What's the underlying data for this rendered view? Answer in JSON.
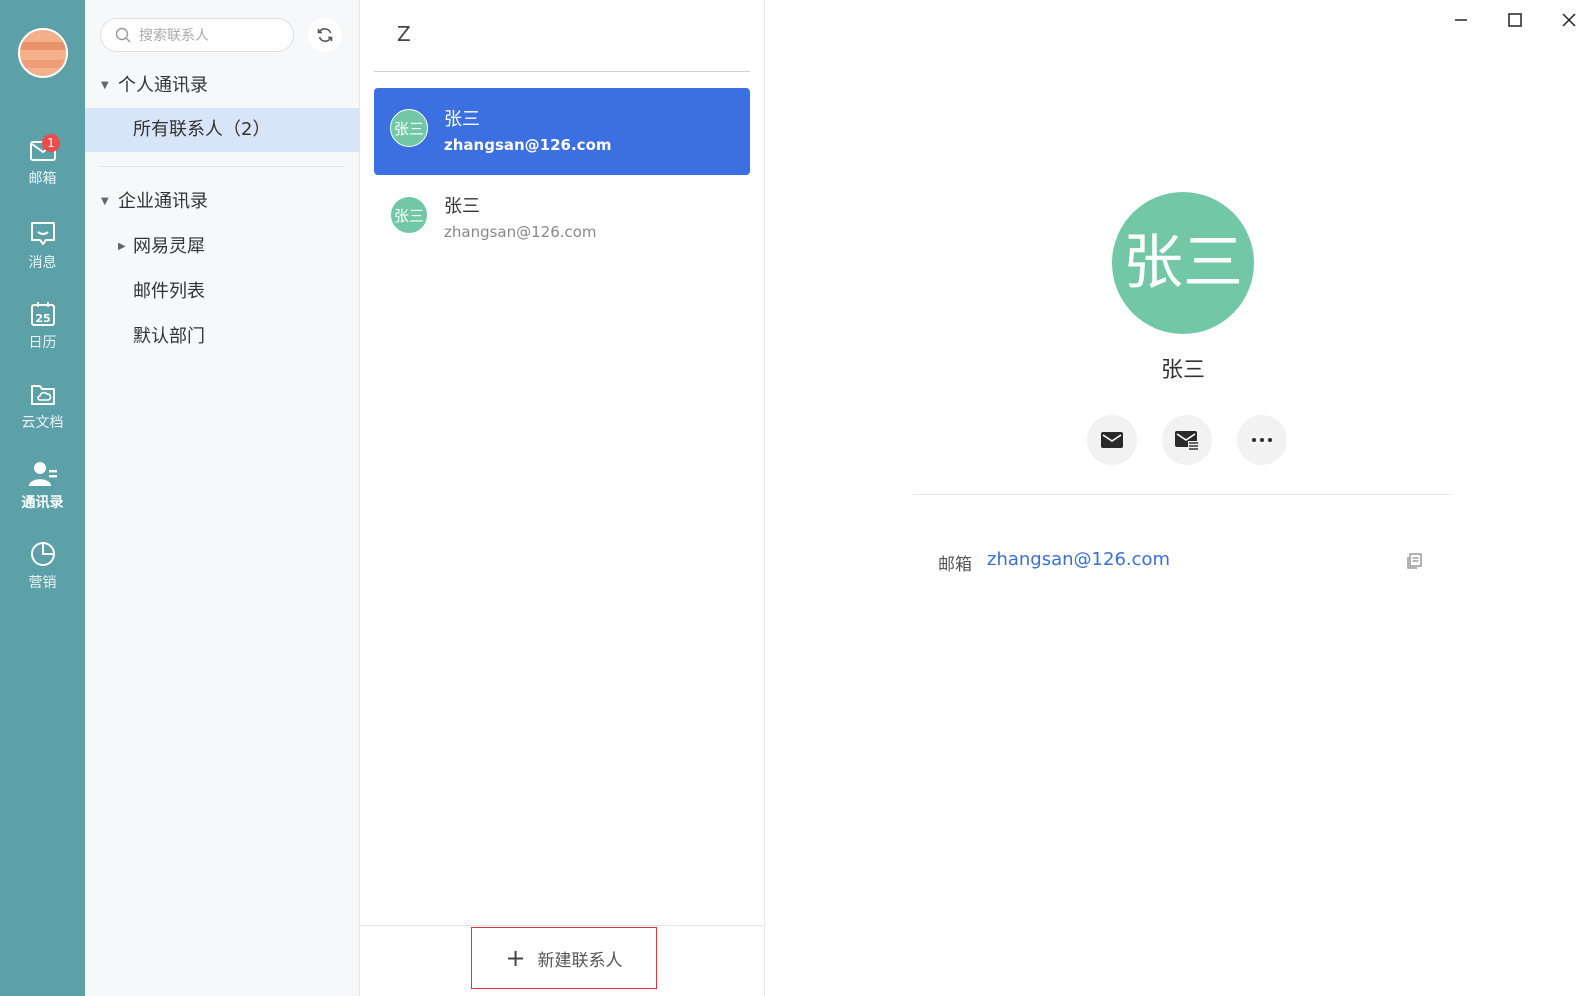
{
  "rail": {
    "items": [
      {
        "label": "邮箱",
        "icon": "mail-icon",
        "badge": "1"
      },
      {
        "label": "消息",
        "icon": "message-icon"
      },
      {
        "label": "日历",
        "icon": "calendar-icon",
        "day": "25"
      },
      {
        "label": "云文档",
        "icon": "cloud-folder-icon"
      },
      {
        "label": "通讯录",
        "icon": "contacts-icon",
        "active": true
      },
      {
        "label": "营销",
        "icon": "pie-chart-icon"
      }
    ]
  },
  "tree": {
    "search_placeholder": "搜索联系人",
    "personal_header": "个人通讯录",
    "all_contacts": "所有联系人（2）",
    "enterprise_header": "企业通讯录",
    "children": [
      "网易灵犀",
      "邮件列表",
      "默认部门"
    ]
  },
  "list": {
    "letter": "Z",
    "contacts": [
      {
        "avatar": "张三",
        "name": "张三",
        "email": "zhangsan@126.com",
        "selected": true
      },
      {
        "avatar": "张三",
        "name": "张三",
        "email": "zhangsan@126.com",
        "selected": false
      }
    ],
    "new_contact": "新建联系人"
  },
  "detail": {
    "avatar": "张三",
    "name": "张三",
    "field_label": "邮箱",
    "field_value": "zhangsan@126.com"
  },
  "colors": {
    "rail": "#5ca0a8",
    "accent": "#3c6fe0",
    "avatar_green": "#72c7a7",
    "badge": "#ef4b4b",
    "highlight_border": "#e0323a"
  }
}
